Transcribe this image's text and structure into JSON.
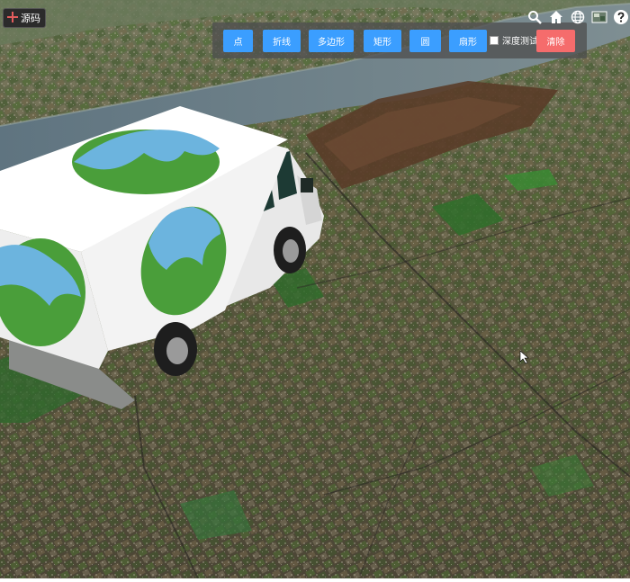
{
  "source_button": {
    "label": "源码",
    "icon": "code-icon"
  },
  "toolbar": {
    "buttons": [
      {
        "label": "点"
      },
      {
        "label": "折线"
      },
      {
        "label": "多边形"
      },
      {
        "label": "矩形"
      },
      {
        "label": "圆"
      },
      {
        "label": "扇形"
      }
    ],
    "depth_test_label": "深度测试",
    "depth_test_checked": false,
    "clear_label": "清除"
  },
  "top_right_icons": [
    "search-icon",
    "home-icon",
    "globe-icon",
    "layers-icon",
    "help-icon"
  ],
  "colors": {
    "button_blue": "#3b9eff",
    "button_red": "#f56c6c",
    "toolbar_bg": "#505050"
  }
}
